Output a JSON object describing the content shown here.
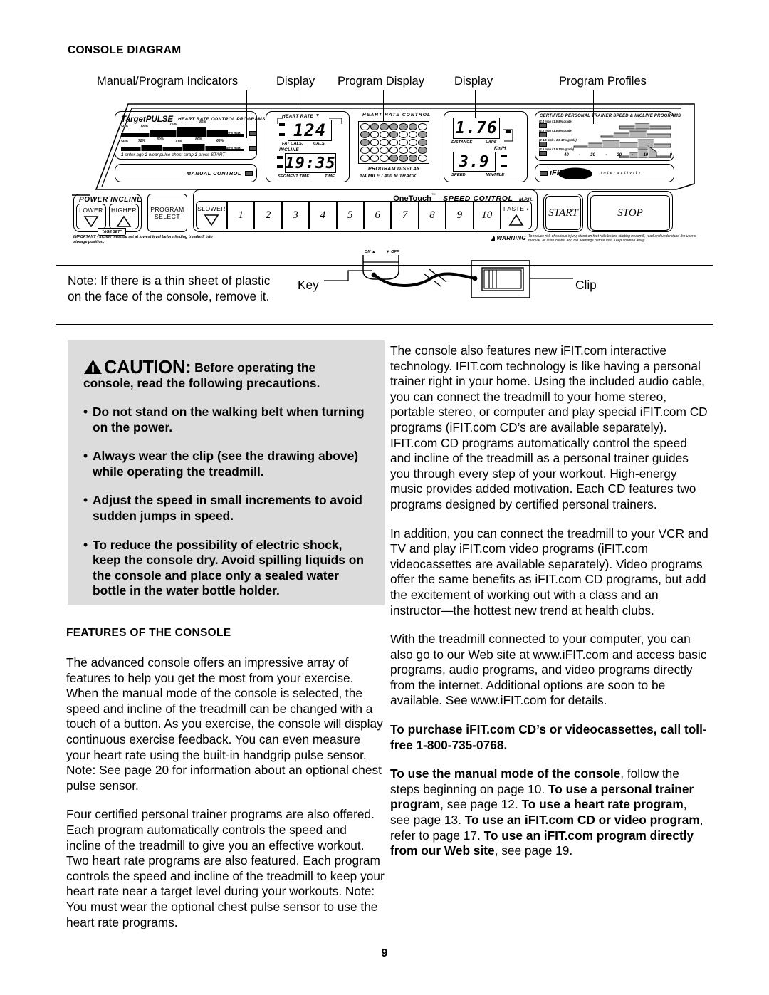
{
  "page": {
    "number": "9"
  },
  "section_title": "CONSOLE DIAGRAM",
  "callouts": [
    {
      "label": "Manual/Program Indicators",
      "name": "callout-manual-program-indicators"
    },
    {
      "label": "Display",
      "name": "callout-display-left"
    },
    {
      "label": "Program Display",
      "name": "callout-program-display"
    },
    {
      "label": "Display",
      "name": "callout-display-right"
    },
    {
      "label": "Program Profiles",
      "name": "callout-program-profiles"
    }
  ],
  "console": {
    "targetpulse": {
      "brand": "TargetPULSE",
      "trademark": "™",
      "subtitle": "HEART RATE CONTROL PROGRAMS",
      "profile_top_labels": [
        "50%",
        "65%",
        "75%",
        "85%",
        "50% max."
      ],
      "profile_bottom_labels": [
        "50%",
        "72%",
        "80%",
        "71%",
        "80%",
        "68%",
        "50% max."
      ],
      "steps": "1  enter age   2  wear pulse chest strap   3  press START",
      "step_items": [
        {
          "num": "1",
          "text": "enter age"
        },
        {
          "num": "2",
          "text": "wear pulse chest strap"
        },
        {
          "num": "3",
          "text": "press START"
        }
      ],
      "manual_control": "MANUAL CONTROL"
    },
    "display_left": {
      "heart_rate_label": "HEART RATE",
      "heart_icon": "♥",
      "heart_rate_value": "124",
      "sub_left": "FAT CALS.",
      "sub_right": "CALS.",
      "incline_label": "INCLINE",
      "time_value": "19:35",
      "sub2_left": "SEGMENT TIME",
      "sub2_right": "TIME"
    },
    "program_display": {
      "title": "HEART RATE CONTROL",
      "caption1": "PROGRAM DISPLAY",
      "caption2": "1/4 MILE / 400 M TRACK",
      "matrix": [
        [
          0,
          1,
          1,
          1,
          1,
          1,
          0
        ],
        [
          1,
          0,
          0,
          1,
          0,
          0,
          1
        ],
        [
          1,
          0,
          0,
          0,
          0,
          0,
          1
        ],
        [
          0,
          0,
          0,
          0,
          0,
          0,
          1
        ],
        [
          0,
          0,
          0,
          1,
          1,
          1,
          0
        ]
      ]
    },
    "display_right": {
      "distance_value": "1.76",
      "sub_left": "DISTANCE",
      "sub_right": "LAPS",
      "kmh_label": "Km/H",
      "speed_value": "3.9",
      "sub2_left": "SPEED",
      "sub2_right": "MIN/MILE"
    },
    "program_profiles": {
      "title": "CERTIFIED PERSONAL TRAINER SPEED & INCLINE PROGRAMS",
      "programs": [
        {
          "spec": "(2.4 mph / 1.5-8% grade)"
        },
        {
          "spec": "(2.5 mph / 1.5-8% grade)"
        },
        {
          "spec": "(2-4.5 mph / 1.5-10% grade)"
        },
        {
          "spec": "(2.6 mph / 1.5-10% grade)"
        }
      ],
      "axis_labels": [
        "40",
        "·",
        "30",
        "·",
        "20",
        "·",
        "10",
        "·",
        "0"
      ],
      "brand": "iFIT.com",
      "brand_tagline": "i n t e r a c t i v i t y"
    },
    "buttons": {
      "power_incline_title": "POWER INCLINE",
      "lower": "LOWER",
      "higher": "HIGHER",
      "age_set": "\"AGE SET\"",
      "program_select_line1": "PROGRAM",
      "program_select_line2": "SELECT",
      "onetouch": "OneTouch",
      "onetouch_tm": "™",
      "speed_control": "SPEED CONTROL",
      "mph": "M.P.H.",
      "slower": "SLOWER",
      "faster": "FASTER",
      "numbers": [
        "1",
        "2",
        "3",
        "4",
        "5",
        "6",
        "7",
        "8",
        "9",
        "10"
      ],
      "start": "START",
      "stop": "STOP"
    },
    "fine_print": {
      "important": "IMPORTANT - Incline must be set at lowest level before folding treadmill into storage position.",
      "warning_word": "WARNING",
      "warning_text": "To reduce risk of serious injury, stand on foot rails before starting treadmill, read and understand the user's manual, all instructions, and the warnings before use.  Keep children away."
    },
    "key_switch": {
      "on": "ON",
      "off": "OFF"
    }
  },
  "note": {
    "line1": "Note: If there is a thin sheet of plastic",
    "line2": "on the face of the console, remove it.",
    "key_label": "Key",
    "clip_label": "Clip"
  },
  "caution": {
    "symbol": "⚠",
    "word": "CAUTION",
    "colon": ":",
    "headline": "Before operating the console, read the following precautions.",
    "bullets": [
      "Do not stand on the walking belt when turning on the power.",
      "Always wear the clip (see the drawing above) while operating the treadmill.",
      "Adjust the speed in small increments to avoid sudden jumps in speed.",
      "To reduce the possibility of electric shock, keep the console dry. Avoid spilling liquids on the console and place only a sealed water bottle in the water bottle holder."
    ]
  },
  "features": {
    "heading": "FEATURES OF THE CONSOLE",
    "paragraph1": "The advanced console offers an impressive array of features to help you get the most from your exercise. When the manual mode of the console is selected, the speed and incline of the treadmill can be changed with a touch of a button. As you exercise, the console will display continuous exercise feedback. You can even measure your heart rate using the built-in handgrip pulse sensor. Note: See page 20 for information about an optional chest pulse sensor.",
    "paragraph2": "Four certified personal trainer programs are also offered. Each program automatically controls the speed and incline of the treadmill to give you an effective workout. Two heart rate programs are also featured. Each program controls the speed and incline of the treadmill to keep your heart rate near a target level during your workouts. Note: You must wear the optional chest pulse sensor to use the heart rate programs."
  },
  "right_column": {
    "paragraph1": "The console also features new iFIT.com interactive technology. IFIT.com technology is like having a personal trainer right in your home. Using the included audio cable, you can connect the treadmill to your home stereo, portable stereo, or computer and play special iFIT.com CD programs (iFIT.com CD’s are available separately). IFIT.com CD programs automatically control the speed and incline of the treadmill as a personal trainer guides you through every step of your workout. High-energy music provides added motivation. Each CD features two programs designed by certified personal trainers.",
    "paragraph2": "In addition, you can connect the treadmill to your VCR and TV and play iFIT.com video programs (iFIT.com videocassettes are available separately). Video programs offer the same benefits as iFIT.com CD programs, but add the excitement of working out with a class and an instructor—the hottest new trend at health clubs.",
    "paragraph3": "With the treadmill connected to your computer, you can also go to our Web site at www.iFIT.com and access basic programs, audio programs, and video programs directly from the internet. Additional options are soon to be available. See www.iFIT.com for details.",
    "purchase_bold": "To purchase iFIT.com CD’s or videocassettes, call toll-free 1-800-735-0768.",
    "instructions": [
      {
        "bold": "To use the manual mode of the console",
        "normal": ", follow the steps beginning on page 10. "
      },
      {
        "bold": "To use a personal trainer program",
        "normal": ", see page 12. "
      },
      {
        "bold": "To use a heart rate program",
        "normal": ", see page 13. "
      },
      {
        "bold": "To use an iFIT.com CD or video program",
        "normal": ", refer to page 17. "
      },
      {
        "bold": "To use an iFIT.com program directly from our Web site",
        "normal": ", see page 19."
      }
    ]
  }
}
